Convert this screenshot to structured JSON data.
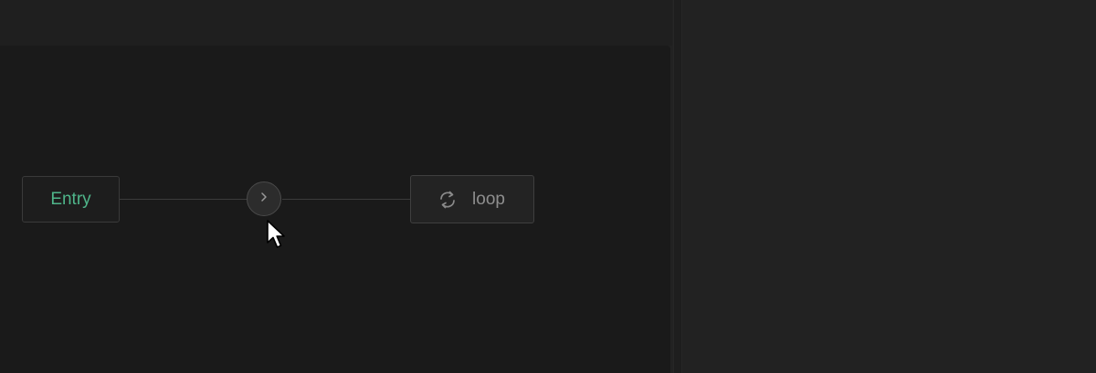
{
  "flow": {
    "nodes": {
      "entry": {
        "label": "Entry"
      },
      "loop": {
        "label": "loop",
        "icon": "loop-icon"
      }
    },
    "connector": {
      "icon": "chevron-right-icon"
    }
  },
  "colors": {
    "entry_accent": "#4fb58a",
    "loop_text": "#8e8e8e",
    "canvas_bg": "#1a1a1a"
  }
}
